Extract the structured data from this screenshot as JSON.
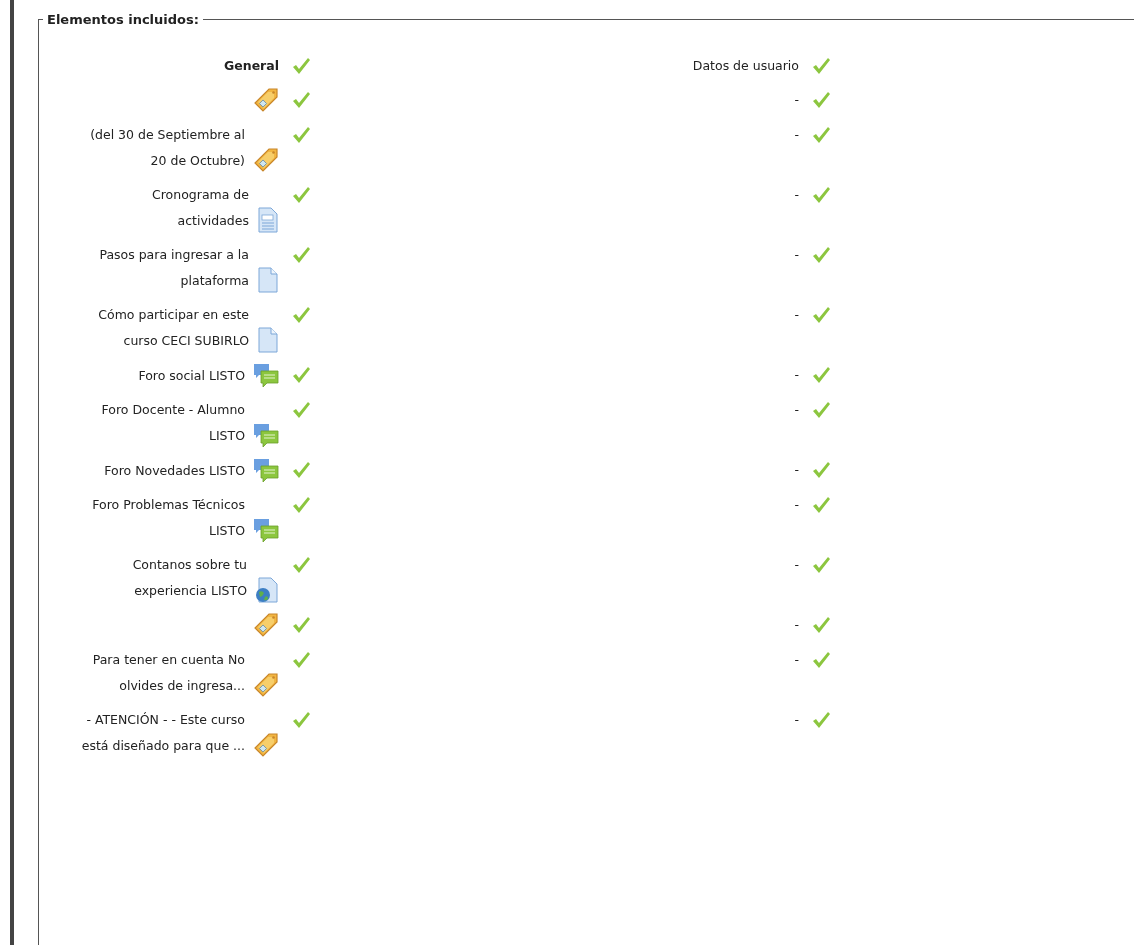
{
  "legend": "Elementos incluidos:",
  "rows": [
    {
      "kind": "section",
      "label": "General",
      "included": true,
      "user_data": "Datos de usuario",
      "user_data_included": true
    },
    {
      "kind": "label",
      "included": true,
      "user_data": "-",
      "user_data_included": true
    },
    {
      "kind": "label",
      "label": "(del 30 de Septiembre al 20 de Octubre)",
      "included": true,
      "user_data": "-",
      "user_data_included": true
    },
    {
      "kind": "page",
      "label": "Cronograma de actividades",
      "included": true,
      "user_data": "-",
      "user_data_included": true
    },
    {
      "kind": "file",
      "label": "Pasos para ingresar a la plataforma",
      "included": true,
      "user_data": "-",
      "user_data_included": true
    },
    {
      "kind": "file",
      "label": "Cómo participar en este curso CECI SUBIRLO",
      "included": true,
      "user_data": "-",
      "user_data_included": true
    },
    {
      "kind": "forum",
      "label": "Foro social LISTO",
      "included": true,
      "user_data": "-",
      "user_data_included": true
    },
    {
      "kind": "forum",
      "label": "Foro Docente - Alumno LISTO",
      "included": true,
      "user_data": "-",
      "user_data_included": true
    },
    {
      "kind": "forum",
      "label": "Foro Novedades LISTO",
      "included": true,
      "user_data": "-",
      "user_data_included": true
    },
    {
      "kind": "forum",
      "label": "Foro Problemas Técnicos LISTO",
      "included": true,
      "user_data": "-",
      "user_data_included": true
    },
    {
      "kind": "url",
      "label": "Contanos sobre tu experiencia LISTO",
      "included": true,
      "user_data": "-",
      "user_data_included": true
    },
    {
      "kind": "label",
      "included": true,
      "user_data": "-",
      "user_data_included": true
    },
    {
      "kind": "label",
      "label": "Para tener en cuenta No olvides de ingresa...",
      "included": true,
      "user_data": "-",
      "user_data_included": true
    },
    {
      "kind": "label",
      "label": "- ATENCIÓN - - Este curso está diseñado para que ...",
      "included": true,
      "user_data": "-",
      "user_data_included": true
    }
  ]
}
